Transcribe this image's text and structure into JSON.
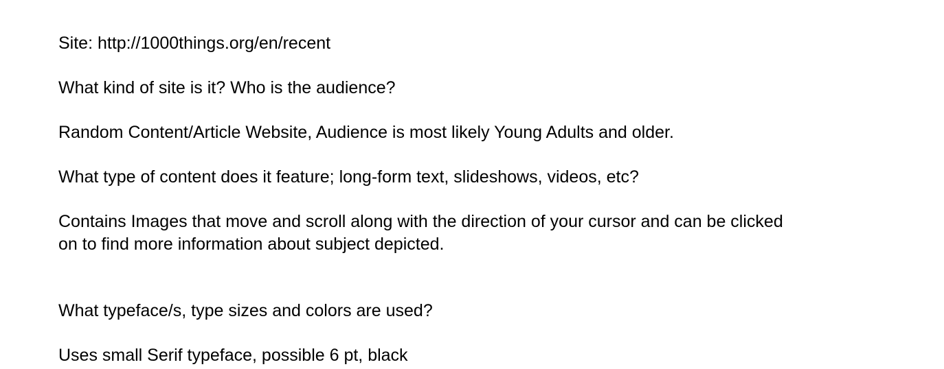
{
  "document": {
    "site_line": "Site: http://1000things.org/en/recent",
    "question_1": "What kind of site is it? Who is the audience?",
    "answer_1": "Random Content/Article Website, Audience is most likely Young Adults and older.",
    "question_2": "What type of content does it feature; long-form text, slideshows, videos, etc?",
    "answer_2_line_1": "Contains Images that move and scroll along with the direction of your cursor and can be clicked",
    "answer_2_line_2": "on to find more information about subject depicted.",
    "question_3": "What typeface/s, type sizes and colors are used?",
    "answer_3": "Uses small Serif typeface, possible 6 pt, black"
  }
}
